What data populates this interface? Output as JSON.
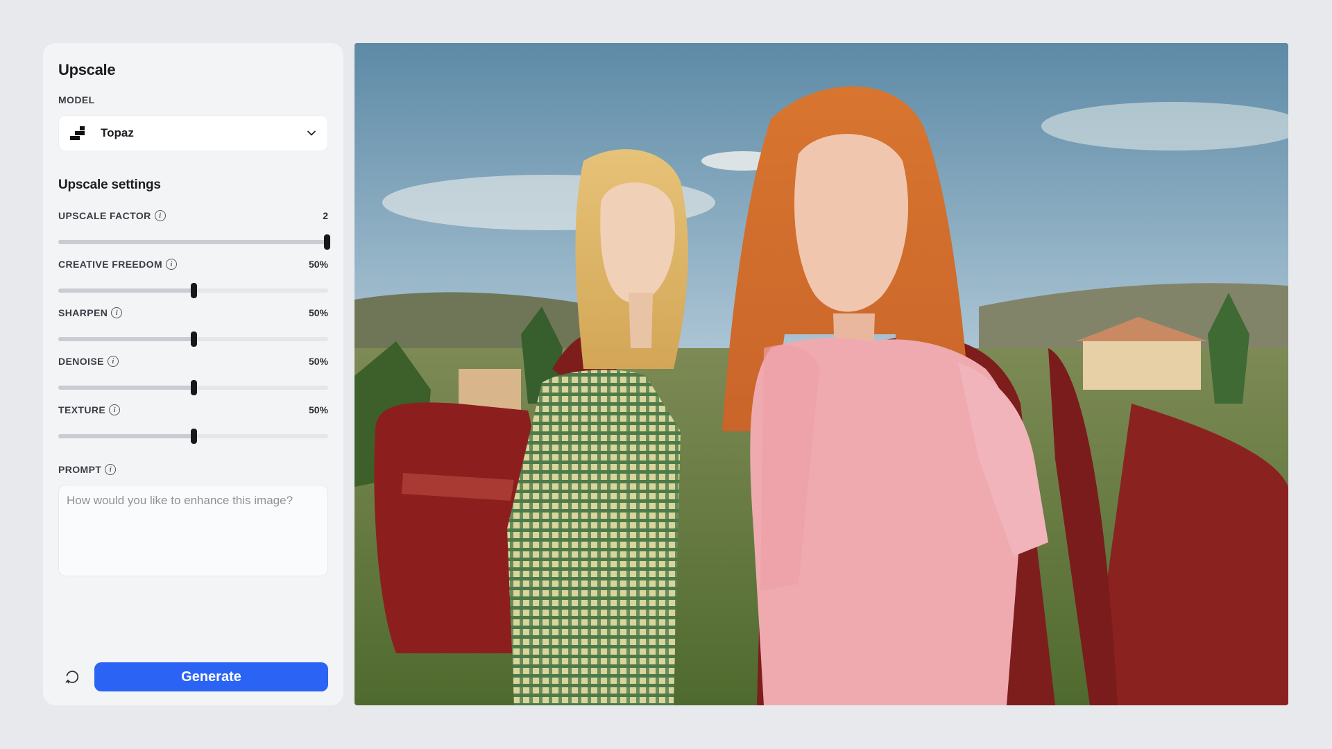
{
  "panel": {
    "title": "Upscale",
    "model_label": "MODEL",
    "model_value": "Topaz",
    "section_title": "Upscale settings"
  },
  "settings": [
    {
      "label": "UPSCALE FACTOR",
      "value_text": "2",
      "fraction": 1.0
    },
    {
      "label": "CREATIVE FREEDOM",
      "value_text": "50%",
      "fraction": 0.5
    },
    {
      "label": "SHARPEN",
      "value_text": "50%",
      "fraction": 0.5
    },
    {
      "label": "DENOISE",
      "value_text": "50%",
      "fraction": 0.5
    },
    {
      "label": "TEXTURE",
      "value_text": "50%",
      "fraction": 0.5
    }
  ],
  "prompt": {
    "label": "PROMPT",
    "placeholder": "How would you like to enhance this image?"
  },
  "footer": {
    "generate_label": "Generate"
  },
  "colors": {
    "accent": "#2b63f5",
    "panel_bg": "#f3f4f6",
    "page_bg": "#e8e9ec"
  },
  "icons": [
    "topaz-logo-icon",
    "chevron-down-icon",
    "info-icon",
    "reset-icon"
  ]
}
